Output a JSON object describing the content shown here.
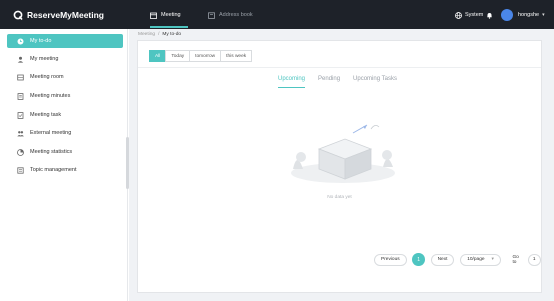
{
  "app": {
    "brand": "ReserveMyMeeting",
    "nav": [
      {
        "label": "Meeting"
      },
      {
        "label": "Address book"
      }
    ],
    "system_label": "System",
    "username": "hongshe"
  },
  "sidebar": {
    "items": [
      {
        "label": "My to-do",
        "icon": "clock-icon",
        "active": true
      },
      {
        "label": "My meeting",
        "icon": "user-icon"
      },
      {
        "label": "Meeting room",
        "icon": "room-icon"
      },
      {
        "label": "Meeting minutes",
        "icon": "document-icon"
      },
      {
        "label": "Meeting task",
        "icon": "task-icon"
      },
      {
        "label": "External meeting",
        "icon": "people-icon"
      },
      {
        "label": "Meeting statistics",
        "icon": "chart-icon"
      },
      {
        "label": "Topic management",
        "icon": "topic-icon"
      }
    ]
  },
  "breadcrumb": {
    "root": "Meeting",
    "separator": "/",
    "current": "My to-do"
  },
  "filters": [
    "All",
    "Today",
    "tomorrow",
    "this week"
  ],
  "tabs": [
    "Upcoming",
    "Pending",
    "Upcoming Tasks"
  ],
  "empty": {
    "text": "No data yet"
  },
  "pagination": {
    "previous": "Previous",
    "current_page": "1",
    "next": "Next",
    "page_size": "10/page",
    "goto_label": "Go to",
    "goto_value": "1"
  },
  "colors": {
    "accent": "#4ec5c1",
    "topbar": "#1e2229",
    "avatar": "#4a86e8"
  }
}
